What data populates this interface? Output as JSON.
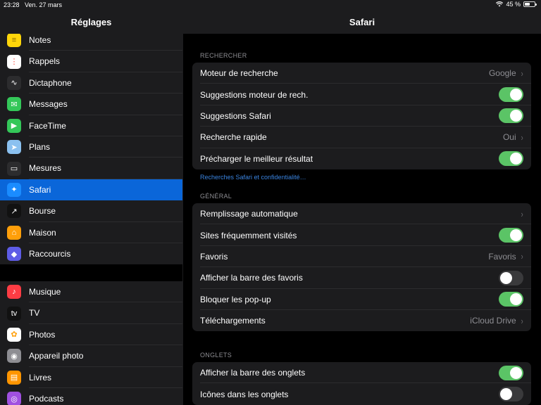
{
  "status": {
    "time": "23:28",
    "date": "Ven. 27 mars",
    "battery": "45 %"
  },
  "sidebar": {
    "title": "Réglages",
    "group1": [
      {
        "label": "Notes",
        "icon": "notes-icon",
        "color": "#ffd60a"
      },
      {
        "label": "Rappels",
        "icon": "reminders-icon",
        "color": "#ffffff"
      },
      {
        "label": "Dictaphone",
        "icon": "voice-memos-icon",
        "color": "#2c2c2e"
      },
      {
        "label": "Messages",
        "icon": "messages-icon",
        "color": "#34c759"
      },
      {
        "label": "FaceTime",
        "icon": "facetime-icon",
        "color": "#34c759"
      },
      {
        "label": "Plans",
        "icon": "maps-icon",
        "color": "#8bc1f0"
      },
      {
        "label": "Mesures",
        "icon": "measure-icon",
        "color": "#2c2c2e"
      },
      {
        "label": "Safari",
        "icon": "safari-icon",
        "color": "#1a8cff",
        "selected": true
      },
      {
        "label": "Bourse",
        "icon": "stocks-icon",
        "color": "#111111"
      },
      {
        "label": "Maison",
        "icon": "home-icon",
        "color": "#ff9f0a"
      },
      {
        "label": "Raccourcis",
        "icon": "shortcuts-icon",
        "color": "#5e5ce6"
      }
    ],
    "group2": [
      {
        "label": "Musique",
        "icon": "music-icon",
        "color": "#fc3c44"
      },
      {
        "label": "TV",
        "icon": "tv-icon",
        "color": "#111111"
      },
      {
        "label": "Photos",
        "icon": "photos-icon",
        "color": "#ffffff"
      },
      {
        "label": "Appareil photo",
        "icon": "camera-icon",
        "color": "#8e8e93"
      },
      {
        "label": "Livres",
        "icon": "books-icon",
        "color": "#ff9500"
      },
      {
        "label": "Podcasts",
        "icon": "podcasts-icon",
        "color": "#a050e0"
      }
    ]
  },
  "main": {
    "title": "Safari",
    "search": {
      "header": "RECHERCHER",
      "rows": [
        {
          "label": "Moteur de recherche",
          "value": "Google",
          "type": "nav"
        },
        {
          "label": "Suggestions moteur de rech.",
          "type": "toggle",
          "on": true
        },
        {
          "label": "Suggestions Safari",
          "type": "toggle",
          "on": true
        },
        {
          "label": "Recherche rapide",
          "value": "Oui",
          "type": "nav"
        },
        {
          "label": "Précharger le meilleur résultat",
          "type": "toggle",
          "on": true
        }
      ],
      "footer": "Recherches Safari et confidentialité…"
    },
    "general": {
      "header": "GÉNÉRAL",
      "rows": [
        {
          "label": "Remplissage automatique",
          "value": "",
          "type": "nav"
        },
        {
          "label": "Sites fréquemment visités",
          "type": "toggle",
          "on": true
        },
        {
          "label": "Favoris",
          "value": "Favoris",
          "type": "nav"
        },
        {
          "label": "Afficher la barre des favoris",
          "type": "toggle",
          "on": false
        },
        {
          "label": "Bloquer les pop-up",
          "type": "toggle",
          "on": true
        },
        {
          "label": "Téléchargements",
          "value": "iCloud Drive",
          "type": "nav"
        }
      ]
    },
    "tabs": {
      "header": "ONGLETS",
      "rows": [
        {
          "label": "Afficher la barre des onglets",
          "type": "toggle",
          "on": true
        },
        {
          "label": "Icônes dans les onglets",
          "type": "toggle",
          "on": false
        }
      ]
    }
  },
  "colors": {
    "accent": "#0a66d9",
    "toggle_on": "#5bc466",
    "link": "#3a84e0"
  }
}
